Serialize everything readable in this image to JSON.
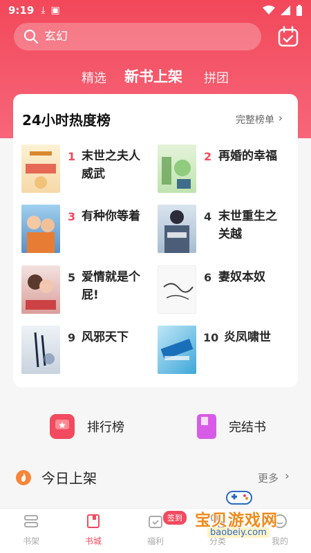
{
  "status": {
    "time": "9:19"
  },
  "search": {
    "placeholder": "玄幻"
  },
  "tabs": [
    {
      "label": "精选",
      "active": false
    },
    {
      "label": "新书上架",
      "active": true
    },
    {
      "label": "拼团",
      "active": false
    }
  ],
  "hot_list": {
    "title": "24小时热度榜",
    "more": "完整榜单",
    "books": [
      {
        "rank": "1",
        "title": "末世之夫人威武"
      },
      {
        "rank": "2",
        "title": "再婚的幸福"
      },
      {
        "rank": "3",
        "title": "有种你等着"
      },
      {
        "rank": "4",
        "title": "末世重生之关越"
      },
      {
        "rank": "5",
        "title": "爱情就是个屁!"
      },
      {
        "rank": "6",
        "title": "妻奴本奴"
      },
      {
        "rank": "9",
        "title": "风邪天下"
      },
      {
        "rank": "10",
        "title": "炎凤啸世"
      }
    ]
  },
  "shortcuts": [
    {
      "label": "排行榜",
      "icon": "ranking-icon",
      "color": "#f24a5e"
    },
    {
      "label": "完结书",
      "icon": "finished-book-icon",
      "color": "#d85be8"
    }
  ],
  "today": {
    "title": "今日上架",
    "more": "更多"
  },
  "nav": {
    "items": [
      {
        "label": "书架",
        "icon": "bookshelf-icon",
        "active": false
      },
      {
        "label": "书城",
        "icon": "bookstore-icon",
        "active": true
      },
      {
        "label": "福利",
        "icon": "calendar-check-icon",
        "active": false
      },
      {
        "label": "分类",
        "icon": "category-icon",
        "active": false
      },
      {
        "label": "我的",
        "icon": "profile-icon",
        "active": false
      }
    ],
    "badge": "签到"
  },
  "watermark": {
    "text": "宝贝游戏网",
    "url": "baobeiy.com"
  },
  "colors": {
    "accent": "#f24a5e",
    "header_top": "#f2485a",
    "header_bottom": "#f7667a"
  }
}
